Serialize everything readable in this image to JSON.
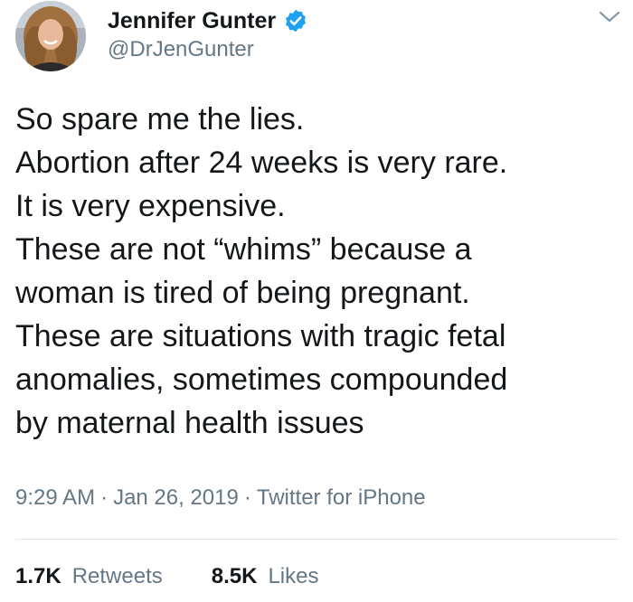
{
  "author": {
    "display_name": "Jennifer Gunter",
    "handle": "@DrJenGunter",
    "verified": true
  },
  "tweet": {
    "lines": [
      "So spare me the lies.",
      "Abortion after 24 weeks is very rare.",
      "It is very expensive.",
      "These are not “whims” because a",
      "woman is tired of being pregnant.",
      "These are situations with tragic fetal",
      "anomalies, sometimes compounded",
      "by maternal health issues"
    ]
  },
  "meta": {
    "time": "9:29 AM",
    "separator": "·",
    "date": "Jan 26, 2019",
    "source": "Twitter for iPhone"
  },
  "stats": {
    "retweets_count": "1.7K",
    "retweets_label": "Retweets",
    "likes_count": "8.5K",
    "likes_label": "Likes"
  },
  "icons": {
    "verified": "verified-badge-icon",
    "menu": "chevron-down-icon"
  },
  "colors": {
    "verified_blue": "#1da1f2",
    "text_primary": "#14171a",
    "text_secondary": "#657786",
    "divider": "#e1e8ed"
  }
}
